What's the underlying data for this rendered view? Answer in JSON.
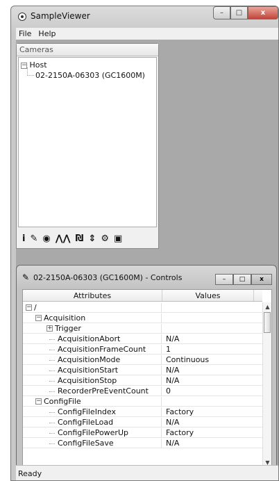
{
  "window": {
    "title": "SampleViewer",
    "min": "–",
    "max": "□",
    "close": "x"
  },
  "menu": [
    "File",
    "Help"
  ],
  "cameras_panel": {
    "title": "Cameras",
    "tree": {
      "root": "Host",
      "child": "02-2150A-06303 (GC1600M)"
    },
    "toolbar_icons": [
      "info-icon",
      "wrench-icon",
      "eye-icon",
      "waveform-icon",
      "register-icon",
      "io-icon",
      "settings-gear-icon",
      "save-icon"
    ]
  },
  "controls": {
    "title": "02-2150A-06303 (GC1600M) - Controls",
    "columns": [
      "Attributes",
      "Values"
    ],
    "rows": [
      {
        "name": "/",
        "value": "",
        "level": 0,
        "toggle": "-"
      },
      {
        "name": "Acquisition",
        "value": "",
        "level": 1,
        "toggle": "-"
      },
      {
        "name": "Trigger",
        "value": "",
        "level": 2,
        "toggle": "+"
      },
      {
        "name": "AcquisitionAbort",
        "value": "N/A",
        "level": 3,
        "toggle": ""
      },
      {
        "name": "AcquisitionFrameCount",
        "value": "1",
        "level": 3,
        "toggle": ""
      },
      {
        "name": "AcquisitionMode",
        "value": "Continuous",
        "level": 3,
        "toggle": ""
      },
      {
        "name": "AcquisitionStart",
        "value": "N/A",
        "level": 3,
        "toggle": ""
      },
      {
        "name": "AcquisitionStop",
        "value": "N/A",
        "level": 3,
        "toggle": ""
      },
      {
        "name": "RecorderPreEventCount",
        "value": "0",
        "level": 3,
        "toggle": ""
      },
      {
        "name": "ConfigFile",
        "value": "",
        "level": 1,
        "toggle": "-"
      },
      {
        "name": "ConfigFileIndex",
        "value": "Factory",
        "level": 3,
        "toggle": ""
      },
      {
        "name": "ConfigFileLoad",
        "value": "N/A",
        "level": 3,
        "toggle": ""
      },
      {
        "name": "ConfigFilePowerUp",
        "value": "Factory",
        "level": 3,
        "toggle": ""
      },
      {
        "name": "ConfigFileSave",
        "value": "N/A",
        "level": 3,
        "toggle": ""
      }
    ]
  },
  "status": "Ready"
}
